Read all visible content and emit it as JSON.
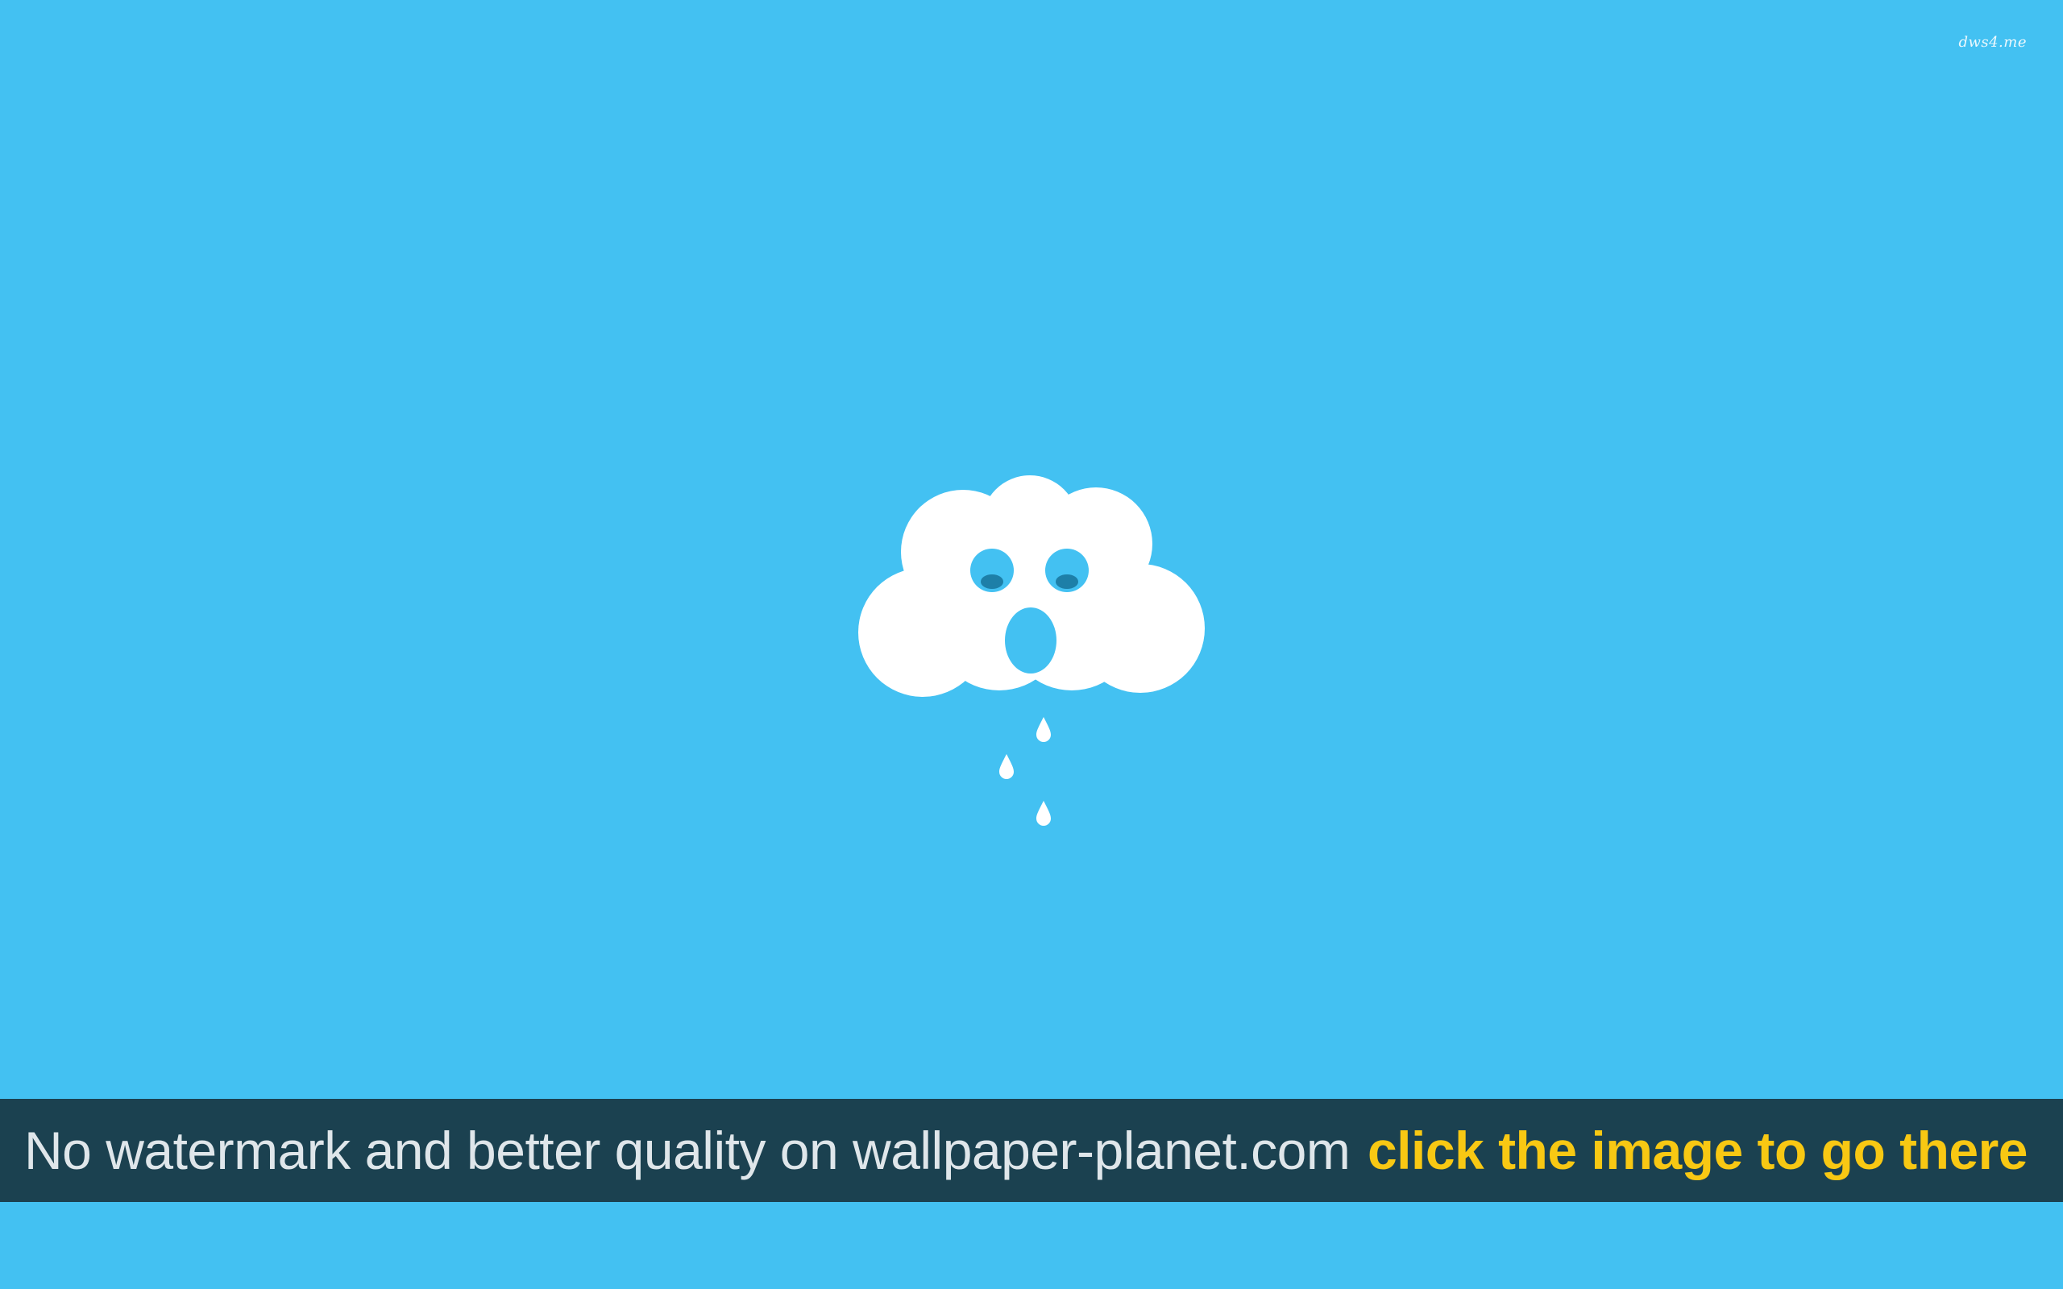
{
  "wallpaper": {
    "background_color": "#43c1f2",
    "watermark_text": "dws4.me",
    "illustration": "crying-cloud-icon",
    "cloud_color": "#ffffff",
    "pupil_color": "#1d7fa8"
  },
  "banner": {
    "background_color": "#1b4150",
    "message": "No watermark and better quality on wallpaper-planet.com",
    "message_color": "#dfe6ea",
    "cta": "click the image to go there",
    "cta_color": "#f8c813"
  }
}
